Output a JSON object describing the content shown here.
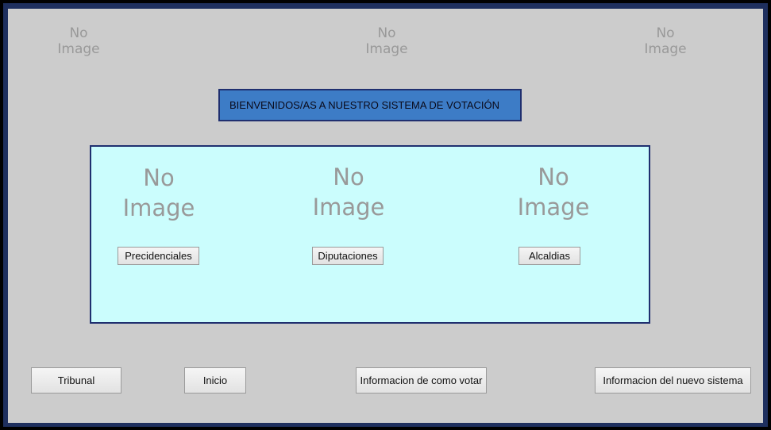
{
  "placeholders": {
    "no_image": "No\nImage"
  },
  "header": {
    "welcome_text": "BIENVENIDOS/AS A NUESTRO SISTEMA DE VOTACIÓN"
  },
  "election_panel": {
    "options": [
      {
        "label": "Precidenciales",
        "icon": "no-image"
      },
      {
        "label": "Diputaciones",
        "icon": "no-image"
      },
      {
        "label": "Alcaldias",
        "icon": "no-image"
      }
    ]
  },
  "footer_nav": {
    "tribunal": "Tribunal",
    "inicio": "Inicio",
    "info_votar": "Informacion de como votar",
    "info_sistema": "Informacion del nuevo sistema"
  },
  "colors": {
    "frame": "#1e2f5e",
    "background": "#cccccc",
    "welcome_bg": "#3d7cc6",
    "panel_bg": "#cbfdfd",
    "placeholder_text": "#999999"
  }
}
